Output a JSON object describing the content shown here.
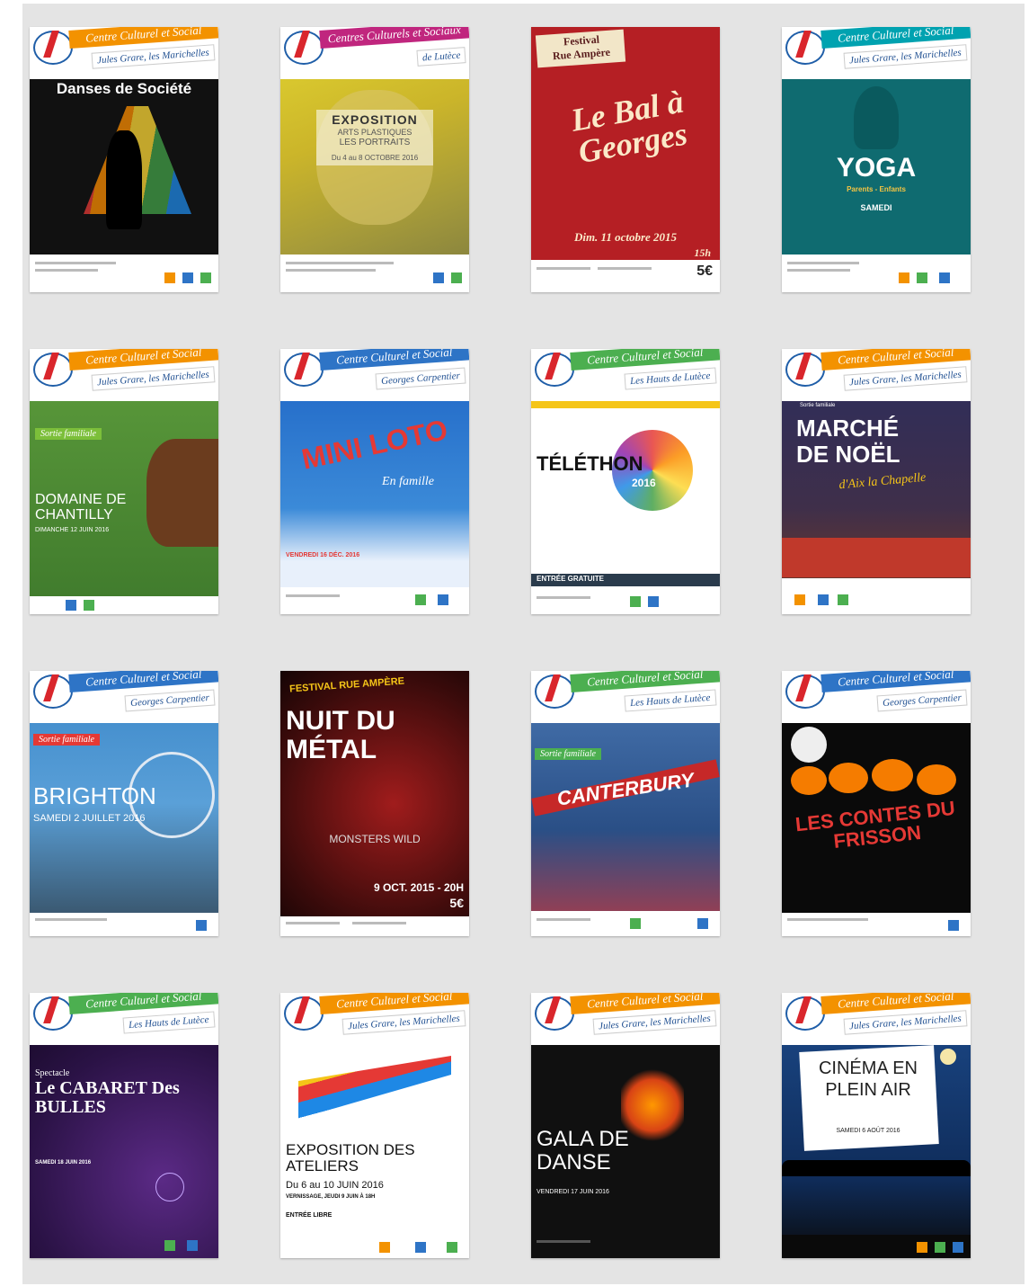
{
  "posters": [
    {
      "header1": "Centre Culturel et Social",
      "header2": "Jules Grare, les Marichelles",
      "title": "Danses de Société"
    },
    {
      "header1": "Centres Culturels et Sociaux",
      "header2": "de Lutèce",
      "title": "EXPOSITION",
      "sub": "ARTS PLASTIQUES",
      "sub2": "LES PORTRAITS",
      "date": "Du 4 au 8 OCTOBRE 2016"
    },
    {
      "header1": "Festival",
      "header2": "Rue Ampère",
      "title": "Le Bal à Georges",
      "date": "Dim. 11 octobre 2015",
      "time": "15h",
      "price": "5€"
    },
    {
      "header1": "Centre Culturel et Social",
      "header2": "Jules Grare, les Marichelles",
      "title": "YOGA",
      "sub": "Parents - Enfants",
      "date": "SAMEDI"
    },
    {
      "header1": "Centre Culturel et Social",
      "header2": "Jules Grare, les Marichelles",
      "tag": "Sortie familiale",
      "title": "DOMAINE DE CHANTILLY",
      "date": "DIMANCHE 12 JUIN 2016"
    },
    {
      "header1": "Centre Culturel et Social",
      "header2": "Georges Carpentier",
      "title": "MINI LOTO",
      "sub": "En famille",
      "date": "VENDREDI 16 DÉC. 2016"
    },
    {
      "header1": "Centre Culturel et Social",
      "header2": "Les Hauts de Lutèce",
      "title": "TÉLÉTHON",
      "year": "2016",
      "footer": "ENTRÉE GRATUITE"
    },
    {
      "header1": "Centre Culturel et Social",
      "header2": "Jules Grare, les Marichelles",
      "tag": "Sortie familiale",
      "title": "MARCHÉ DE NOËL",
      "sub": "d'Aix la Chapelle"
    },
    {
      "header1": "Centre Culturel et Social",
      "header2": "Georges Carpentier",
      "tag": "Sortie familiale",
      "title": "BRIGHTON",
      "date": "SAMEDI 2 JUILLET 2016"
    },
    {
      "header1": "FESTIVAL RUE AMPÈRE",
      "title": "NUIT DU MÉTAL",
      "sub": "MONSTERS   WILD",
      "date": "9 OCT. 2015 - 20H",
      "price": "5€"
    },
    {
      "header1": "Centre Culturel et Social",
      "header2": "Les Hauts de Lutèce",
      "tag": "Sortie familiale",
      "title": "CANTERBURY"
    },
    {
      "header1": "Centre Culturel et Social",
      "header2": "Georges Carpentier",
      "title": "LES CONTES DU FRISSON"
    },
    {
      "header1": "Centre Culturel et Social",
      "header2": "Les Hauts de Lutèce",
      "tag": "Spectacle",
      "title": "Le CABARET Des BULLES",
      "date": "SAMEDI 18 JUIN 2016"
    },
    {
      "header1": "Centre Culturel et Social",
      "header2": "Jules Grare, les Marichelles",
      "title": "EXPOSITION DES ATELIERS",
      "date": "Du 6 au 10 JUIN 2016",
      "sub": "VERNISSAGE, JEUDI 9 JUIN À 18H",
      "footer": "ENTRÉE LIBRE"
    },
    {
      "header1": "Centre Culturel et Social",
      "header2": "Jules Grare, les Marichelles",
      "title": "GALA DE DANSE",
      "date": "VENDREDI 17 JUIN 2016"
    },
    {
      "header1": "Centre Culturel et Social",
      "header2": "Jules Grare, les Marichelles",
      "title": "CINÉMA EN PLEIN AIR",
      "date": "SAMEDI 6 AOÛT 2016"
    }
  ],
  "colors": {
    "orange": "#f39200",
    "teal": "#00a2b0",
    "red": "#b51f24",
    "blue": "#2e74c6",
    "green": "#4caf50",
    "magenta": "#c0267e"
  }
}
